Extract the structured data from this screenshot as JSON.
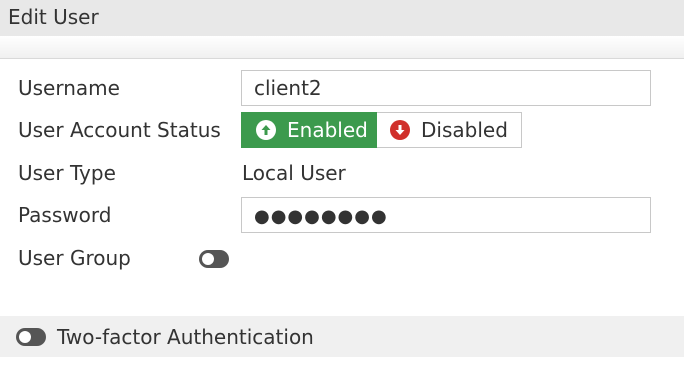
{
  "dialog": {
    "title": "Edit User"
  },
  "form": {
    "username": {
      "label": "Username",
      "value": "client2"
    },
    "account_status": {
      "label": "User Account Status",
      "enabled_label": "Enabled",
      "disabled_label": "Disabled",
      "selected": "Enabled",
      "enabled_icon": "arrow-up-circle-icon",
      "disabled_icon": "arrow-down-circle-icon",
      "enabled_color": "#3c9a4d",
      "disabled_icon_color": "#d0302b"
    },
    "user_type": {
      "label": "User Type",
      "value": "Local User"
    },
    "password": {
      "label": "Password",
      "value": "●●●●●●●●"
    },
    "user_group": {
      "label": "User Group",
      "toggle_on": false
    }
  },
  "two_factor": {
    "label": "Two-factor Authentication",
    "toggle_on": false
  }
}
